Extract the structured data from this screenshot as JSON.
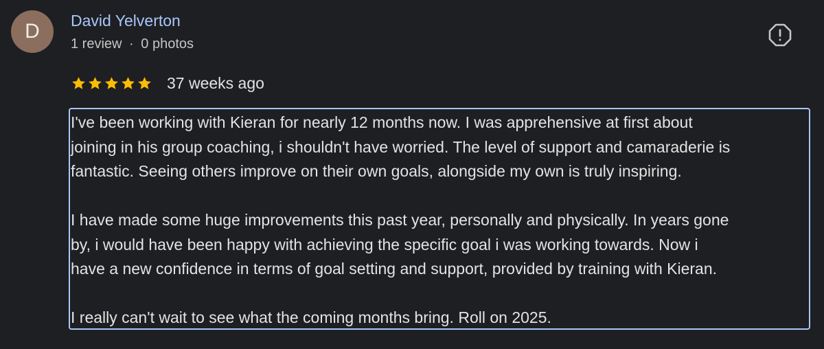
{
  "reviewer": {
    "avatar_initial": "D",
    "avatar_color": "#8c6e5e",
    "name": "David Yelverton",
    "review_count": "1 review",
    "separator": "·",
    "photo_count": "0 photos"
  },
  "rating": {
    "stars": 5,
    "max_stars": 5,
    "star_color": "#fbbc04",
    "date": "37 weeks ago"
  },
  "report_icon": "alert-octagon-icon",
  "review": {
    "paragraph1": [
      "I've been working with Kieran for nearly 12 months now. I was apprehensive at first about",
      "joining in his group coaching, i shouldn't have worried. The level of support and camaraderie is",
      "fantastic. Seeing others improve on their own goals, alongside my own is truly inspiring."
    ],
    "paragraph2": [
      "I have made some huge improvements this past year, personally and physically. In years gone",
      "by, i would have been happy with achieving the specific goal i was working towards. Now i",
      "have a new confidence in terms of goal setting and support, provided by training with Kieran."
    ],
    "paragraph3": [
      "I really can't wait to see what the coming months bring. Roll on 2025."
    ]
  },
  "colors": {
    "background": "#1e1f22",
    "accent": "#a8c7fa",
    "text": "#e3e3e3"
  }
}
